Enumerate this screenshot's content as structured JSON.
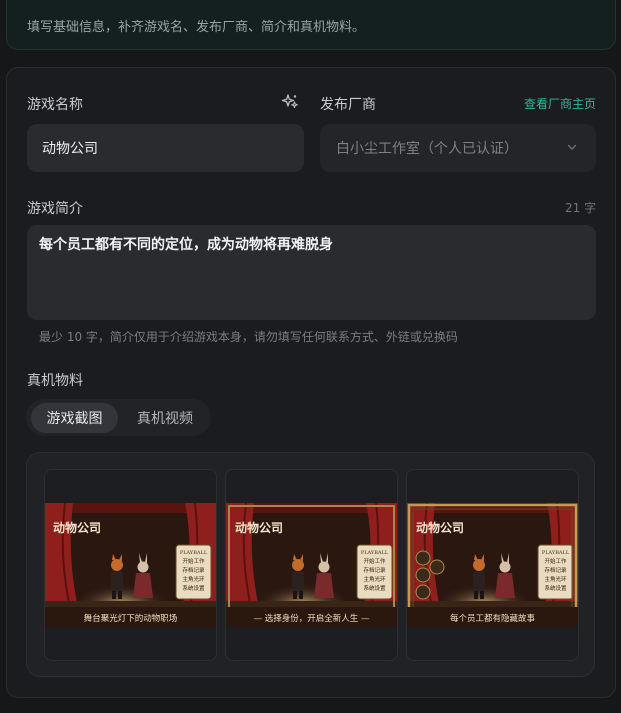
{
  "top": {
    "description": "填写基础信息，补齐游戏名、发布厂商、简介和真机物料。"
  },
  "form": {
    "game_name_label": "游戏名称",
    "game_name_value": "动物公司",
    "publisher_label": "发布厂商",
    "publisher_link": "查看厂商主页",
    "publisher_value": "白小尘工作室（个人已认证）",
    "intro_label": "游戏简介",
    "intro_count": "21 字",
    "intro_value": "每个员工都有不同的定位，成为动物将再难脱身",
    "intro_hint": "最少 10 字，简介仅用于介绍游戏本身，请勿填写任何联系方式、外链或兑换码",
    "assets_label": "真机物料",
    "tabs": [
      {
        "label": "游戏截图",
        "active": true
      },
      {
        "label": "真机视频",
        "active": false
      }
    ]
  },
  "screenshots": [
    {
      "title": "动物公司",
      "sign": "PLAYBALL",
      "sign_lines": [
        "开始工作",
        "存档记录",
        "主角光环",
        "系统设置"
      ],
      "caption": "舞台聚光灯下的动物职场"
    },
    {
      "title": "动物公司",
      "sign": "PLAYBALL",
      "sign_lines": [
        "开始工作",
        "存档记录",
        "主角光环",
        "系统设置"
      ],
      "caption": "— 选择身份，开启全新人生 —"
    },
    {
      "title": "动物公司",
      "sign": "PLAYBALL",
      "sign_lines": [
        "开始工作",
        "存档记录",
        "主角光环",
        "系统设置"
      ],
      "caption": "每个员工都有隐藏故事"
    }
  ],
  "colors": {
    "accent": "#2fb79a",
    "curtain": "#8e1f1c",
    "stage": "#3a2415"
  }
}
